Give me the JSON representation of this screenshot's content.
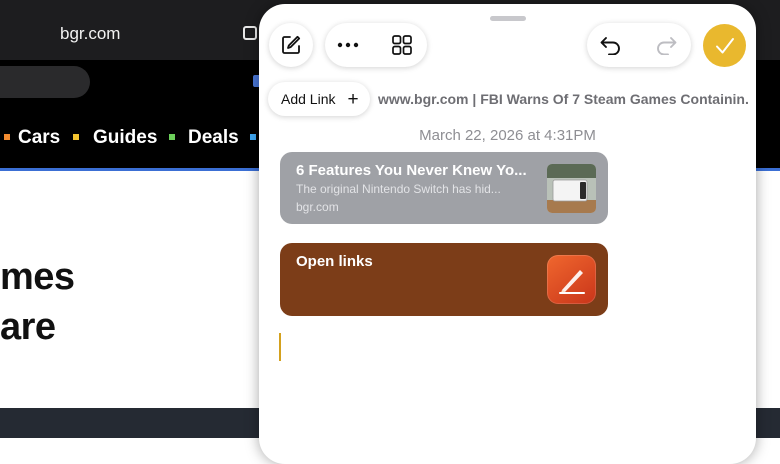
{
  "browser": {
    "url": "bgr.com",
    "nav_items": [
      "Cars",
      "Guides",
      "Deals"
    ],
    "nav_colors": [
      "#f28b30",
      "#f4c430",
      "#6ccf5a",
      "#3fa9f5"
    ],
    "headline_fragments": [
      "mes",
      "are"
    ]
  },
  "quick_note": {
    "toolbar": {
      "compose_icon": "compose-icon",
      "more_icon": "ellipsis-icon",
      "grid_icon": "grid-icon",
      "undo_icon": "undo-icon",
      "redo_icon": "redo-icon",
      "done_icon": "checkmark-icon",
      "accent": "#e9b82e"
    },
    "add_link_label": "Add Link",
    "link_page_title": "www.bgr.com | FBI Warns Of 7 Steam Games Containin...",
    "date": "March 22, 2026 at 4:31PM",
    "link_card": {
      "title": "6 Features You Never Knew Yo...",
      "description": "The original Nintendo Switch has hid...",
      "domain": "bgr.com",
      "color": "#9fa1a6"
    },
    "shortcut_card": {
      "title": "Open links",
      "color": "#7c3d18"
    }
  }
}
